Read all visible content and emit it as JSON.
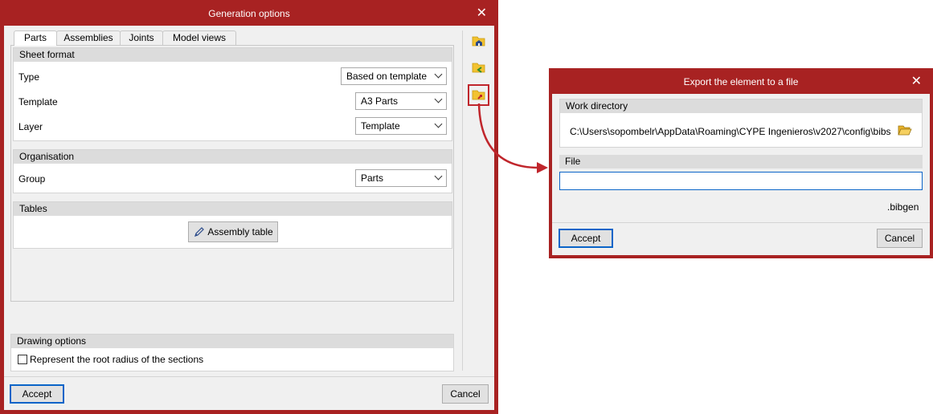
{
  "gen": {
    "title": "Generation options",
    "tabs": [
      "Parts",
      "Assemblies",
      "Joints",
      "Model views"
    ],
    "sheet_format": {
      "header": "Sheet format",
      "type_label": "Type",
      "type_value": "Based on template",
      "template_label": "Template",
      "template_value": "A3 Parts",
      "layer_label": "Layer",
      "layer_value": "Template"
    },
    "organisation": {
      "header": "Organisation",
      "group_label": "Group",
      "group_value": "Parts"
    },
    "tables": {
      "header": "Tables",
      "assembly_table_label": "Assembly table"
    },
    "drawing_options": {
      "header": "Drawing options",
      "root_radius_label": "Represent the root radius of the sections",
      "root_radius_checked": false
    },
    "accept_label": "Accept",
    "cancel_label": "Cancel"
  },
  "exp": {
    "title": "Export the element to a file",
    "work_directory_header": "Work directory",
    "work_directory_path": "C:\\Users\\sopombelr\\AppData\\Roaming\\CYPE Ingenieros\\v2027\\config\\bibs",
    "file_header": "File",
    "file_value": "",
    "extension": ".bibgen",
    "accept_label": "Accept",
    "cancel_label": "Cancel"
  },
  "colors": {
    "frame": "#a82222",
    "accent": "#0a64c8",
    "callout": "#c0262c"
  }
}
